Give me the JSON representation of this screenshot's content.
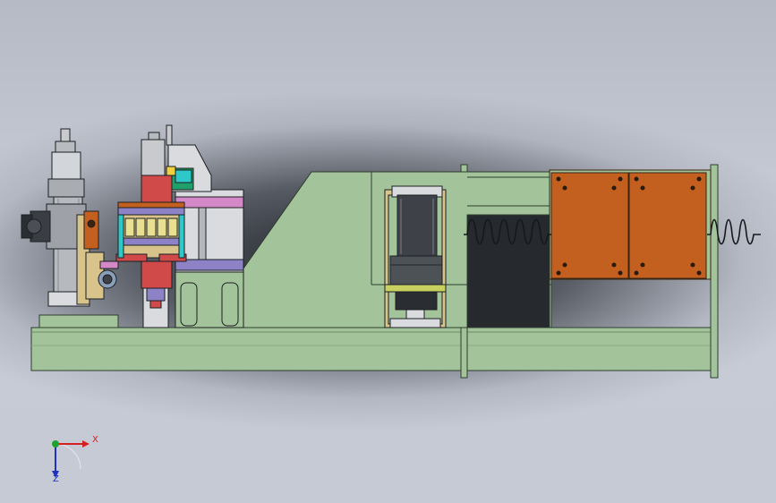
{
  "axis_triad": {
    "x_label": "X",
    "z_label": "Z",
    "x_color": "#d42020",
    "y_color": "#20a030",
    "z_color": "#2030c0"
  },
  "colors": {
    "frame_green": "#a3c49a",
    "frame_outline": "#2e3d2e",
    "orange_panel": "#c3601f",
    "purple": "#8d82c6",
    "magenta": "#d488c8",
    "red_block": "#d04a4a",
    "yellow": "#f0d040",
    "tan": "#d8c48a",
    "cyan": "#2ec8c8",
    "gray_light": "#d9dbde",
    "gray_dark": "#3e4248",
    "background": "#c4c8d2"
  }
}
